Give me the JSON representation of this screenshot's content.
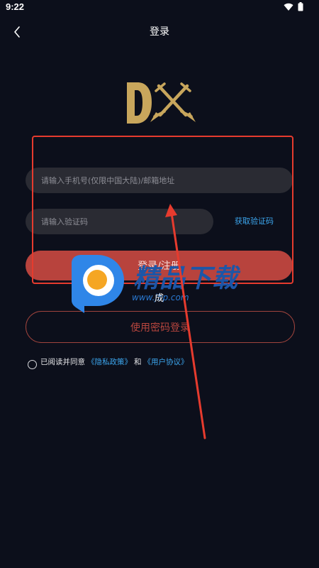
{
  "status_bar": {
    "time": "9:22",
    "icons": [
      "wifi-icon",
      "battery-icon"
    ]
  },
  "nav": {
    "title": "登录"
  },
  "form": {
    "phone_placeholder": "请输入手机号(仅限中国大陆)/邮箱地址",
    "code_placeholder": "请输入验证码",
    "get_code_label": "获取验证码",
    "login_label": "登录/注册",
    "password_login_label": "使用密码登录"
  },
  "agreement": {
    "prefix": "已阅读并同意",
    "privacy_link": "《隐私政策》",
    "conjunction": "和",
    "user_agreement_link": "《用户协议》"
  },
  "watermark": {
    "brand_text": "精品下载",
    "url": "www.jb",
    "url_tail": "p.com",
    "ghost_char": "成"
  },
  "colors": {
    "background": "#0c0f1b",
    "accent_red": "#b8433d",
    "link_blue": "#3ca6ee",
    "logo_gold": "#c8a65c",
    "annotation_red": "#e63b2e"
  }
}
